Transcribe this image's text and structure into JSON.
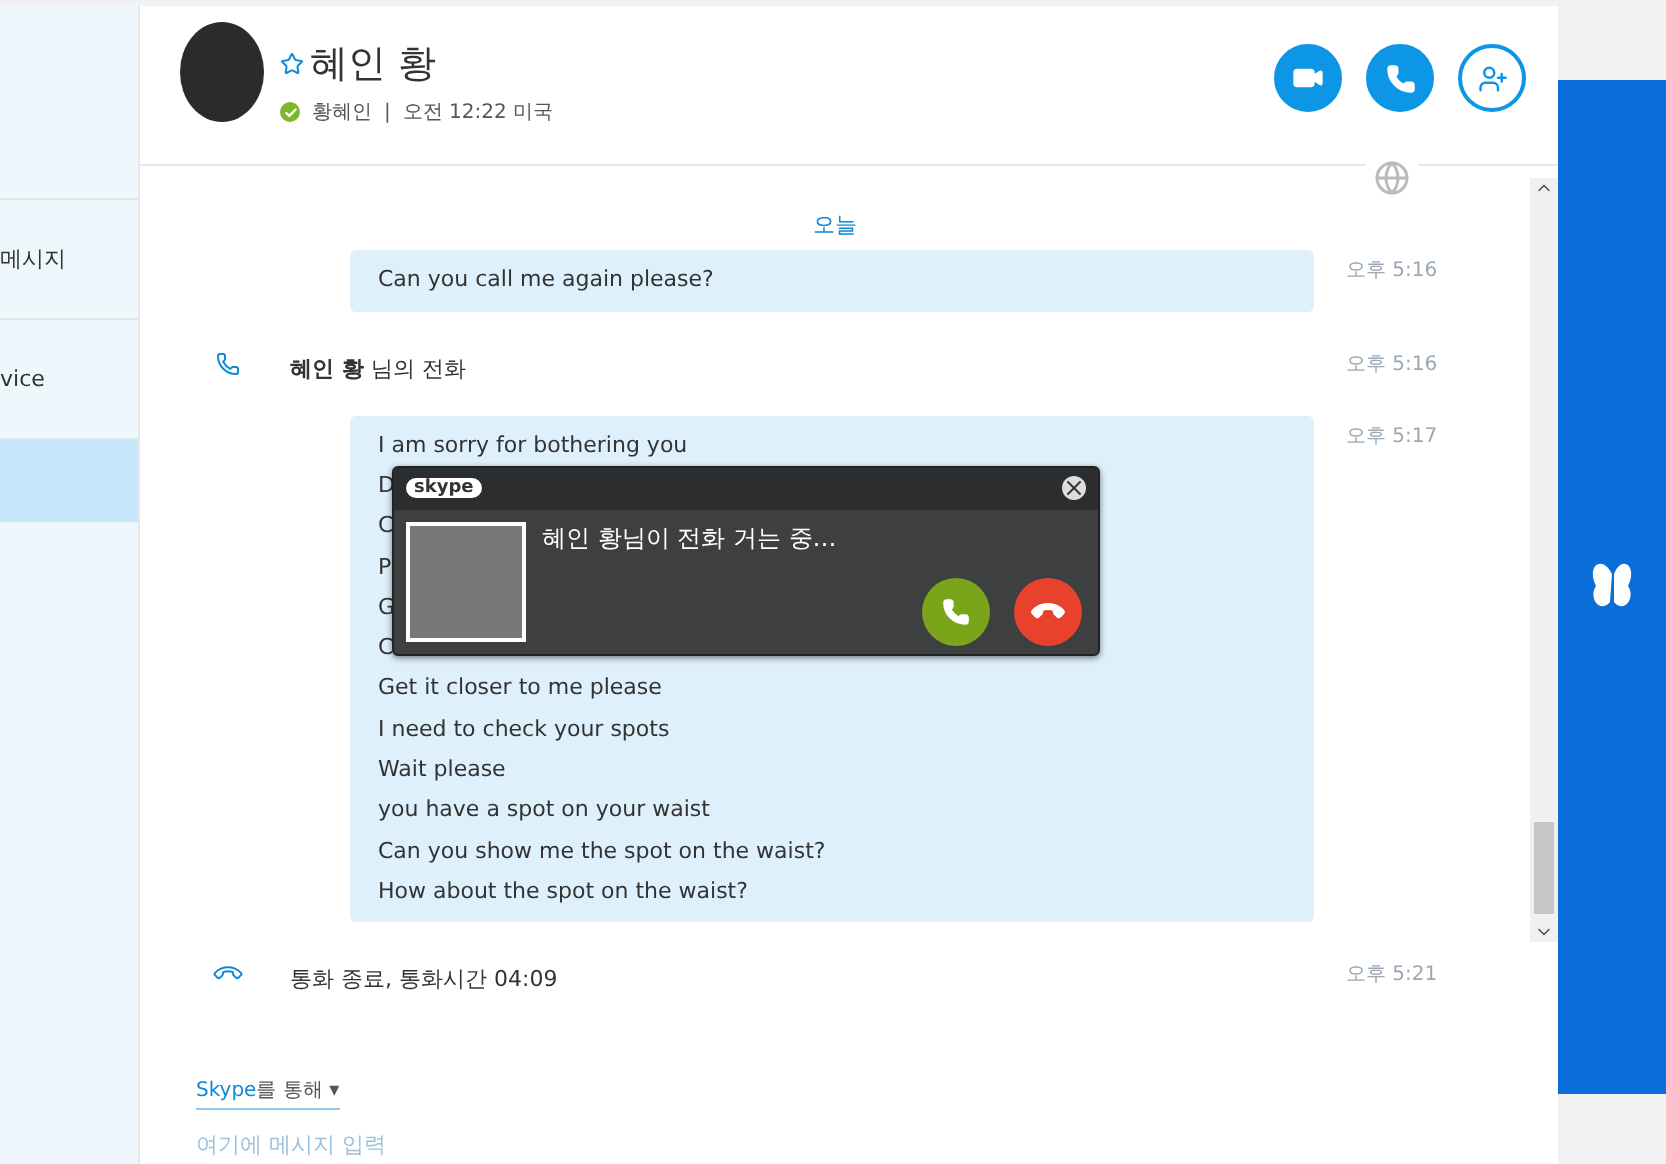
{
  "sidebar": {
    "items": [
      {
        "label": "메시지",
        "selected": false
      },
      {
        "label": "vice",
        "selected": false
      },
      {
        "selected": true
      }
    ]
  },
  "header": {
    "name": "혜인 황",
    "favorite": false,
    "online": true,
    "username": "황혜인",
    "separator": "|",
    "local_time": "오전 12:22 미국"
  },
  "chat": {
    "date_divider": "오늘",
    "messages": [
      {
        "kind": "bubble",
        "lines": [
          "Can you call me again please?"
        ],
        "time": "오후 5:16"
      },
      {
        "kind": "call",
        "name": "혜인 황",
        "text": "님의 전화",
        "time": "오후 5:16"
      },
      {
        "kind": "bubble",
        "lines": [
          "I am sorry for bothering you",
          "D",
          "C",
          "P",
          "G",
          "C",
          "Get it closer to me please",
          "I need to check your spots",
          "Wait please",
          "you have a spot on your waist",
          "Can you show me the spot on the waist?",
          "How about the spot on the waist?"
        ],
        "time": "오후 5:17"
      },
      {
        "kind": "call_end",
        "text": "통화 종료, 통화시간 04:09",
        "time": "오후 5:21"
      }
    ]
  },
  "incoming_call": {
    "brand": "skype",
    "text": "혜인 황님이 전화 거는 중…"
  },
  "compose": {
    "via_brand": "Skype",
    "via_text": "를 통해",
    "caret": "▾",
    "placeholder": "여기에 메시지 입력"
  }
}
